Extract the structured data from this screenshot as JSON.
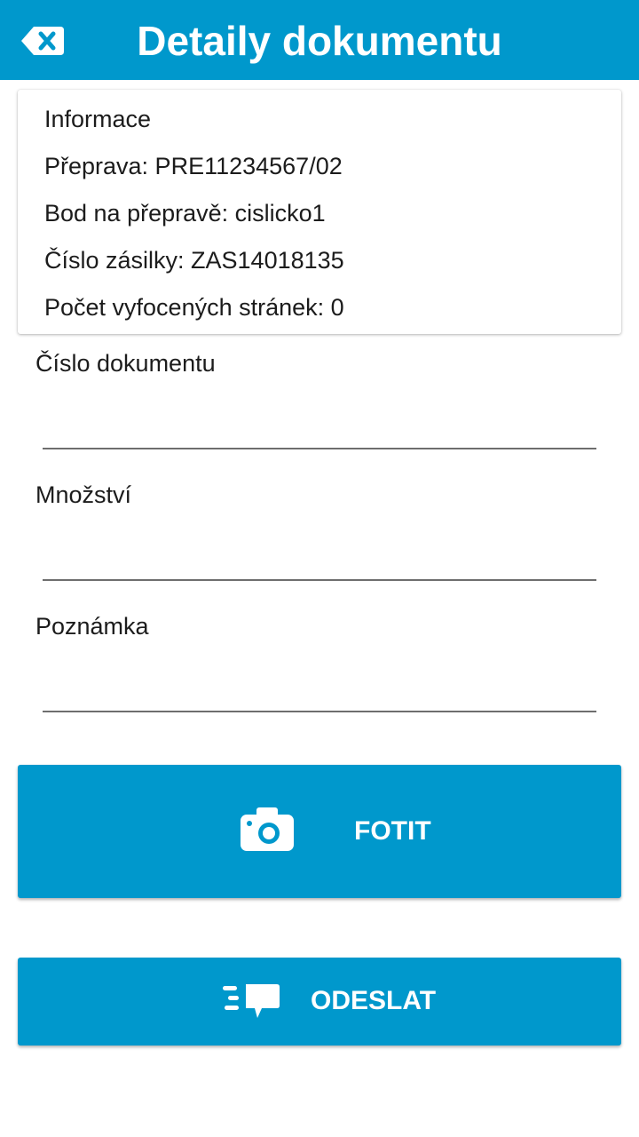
{
  "header": {
    "title": "Detaily dokumentu",
    "back_icon": "backspace-close-icon"
  },
  "info": {
    "heading": "Informace",
    "lines": [
      "Přeprava: PRE11234567/02",
      "Bod na přepravě: cislicko1",
      "Číslo zásilky: ZAS14018135",
      "Počet vyfocených stránek: 0"
    ]
  },
  "form": {
    "document_number": {
      "label": "Číslo dokumentu",
      "value": ""
    },
    "quantity": {
      "label": "Množství",
      "value": ""
    },
    "note": {
      "label": "Poznámka",
      "value": ""
    }
  },
  "buttons": {
    "photo": {
      "label": "FOTIT",
      "icon": "camera-icon"
    },
    "send": {
      "label": "ODESLAT",
      "icon": "send-message-icon"
    }
  },
  "colors": {
    "primary": "#0098cc",
    "text": "#1c1c1c",
    "on_primary": "#ffffff"
  }
}
